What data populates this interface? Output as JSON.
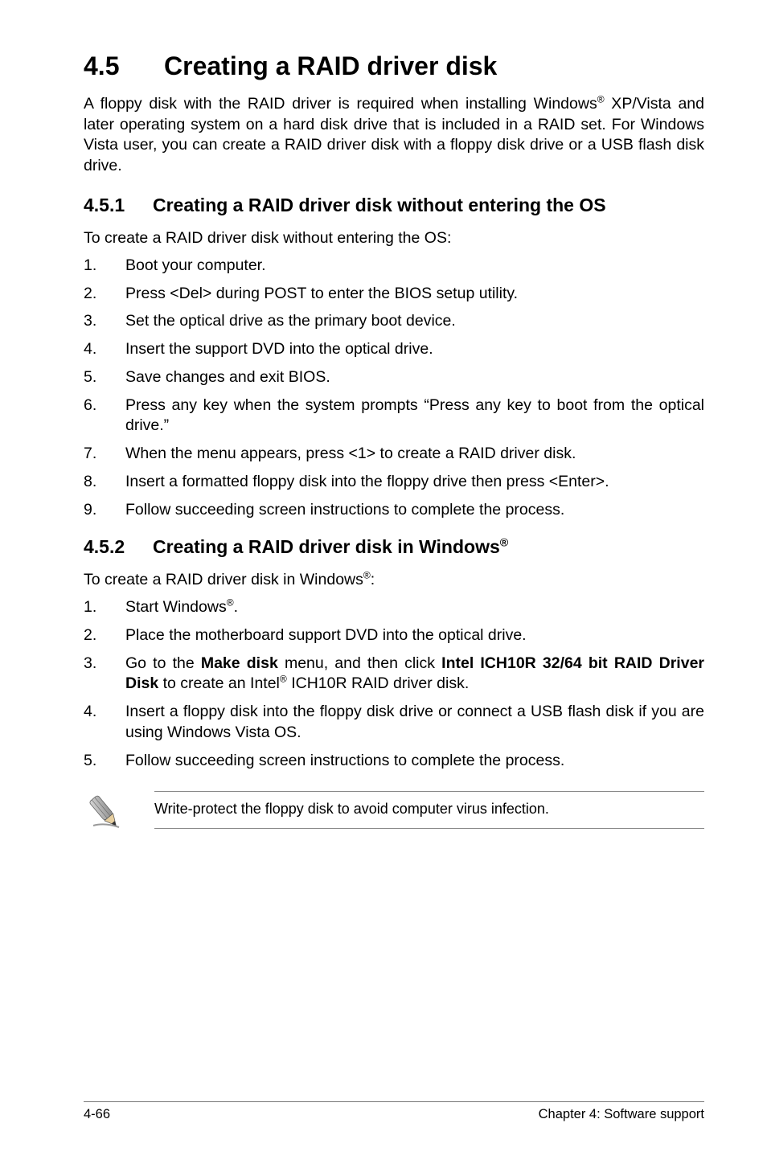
{
  "heading": {
    "number": "4.5",
    "title": "Creating a RAID driver disk"
  },
  "intro": {
    "part1": "A floppy disk with the RAID driver is required when installing Windows",
    "reg1": "®",
    "part2": " XP/Vista and later operating system on a hard disk drive that is included in a RAID set. For Windows Vista user, you can create a RAID driver disk with a floppy disk drive or a USB flash disk drive."
  },
  "section1": {
    "number": "4.5.1",
    "title": "Creating a RAID driver disk without entering the OS",
    "lead": "To create a RAID driver disk without entering the OS:",
    "steps": [
      "Boot your computer.",
      "Press <Del> during POST to enter the BIOS setup utility.",
      "Set the optical drive as the primary boot device.",
      "Insert the support DVD into the optical drive.",
      "Save changes and exit BIOS.",
      "Press any key when the system prompts “Press any key to boot from the optical drive.”",
      "When the menu appears, press <1> to create a RAID driver disk.",
      "Insert a formatted floppy disk into the floppy drive then press <Enter>.",
      "Follow succeeding screen instructions to complete the process."
    ]
  },
  "section2": {
    "number": "4.5.2",
    "title_prefix": "Creating a RAID driver disk in Windows",
    "title_reg": "®",
    "lead_prefix": "To create a RAID driver disk in Windows",
    "lead_reg": "®",
    "lead_suffix": ":",
    "step1_prefix": "Start Windows",
    "step1_reg": "®",
    "step1_suffix": ".",
    "step2": "Place the motherboard support DVD into the optical drive.",
    "step3_a": "Go to the ",
    "step3_b": "Make disk",
    "step3_c": " menu, and then click ",
    "step3_d": "Intel ICH10R 32/64 bit RAID Driver Disk",
    "step3_e": " to create an Intel",
    "step3_reg": "®",
    "step3_f": " ICH10R RAID driver disk.",
    "step4": "Insert a floppy disk into the floppy disk drive or connect a USB flash disk if you are using Windows Vista OS.",
    "step5": "Follow succeeding screen instructions to complete the process."
  },
  "note": "Write-protect the floppy disk to avoid computer virus infection.",
  "footer": {
    "left": "4-66",
    "right": "Chapter 4: Software support"
  }
}
